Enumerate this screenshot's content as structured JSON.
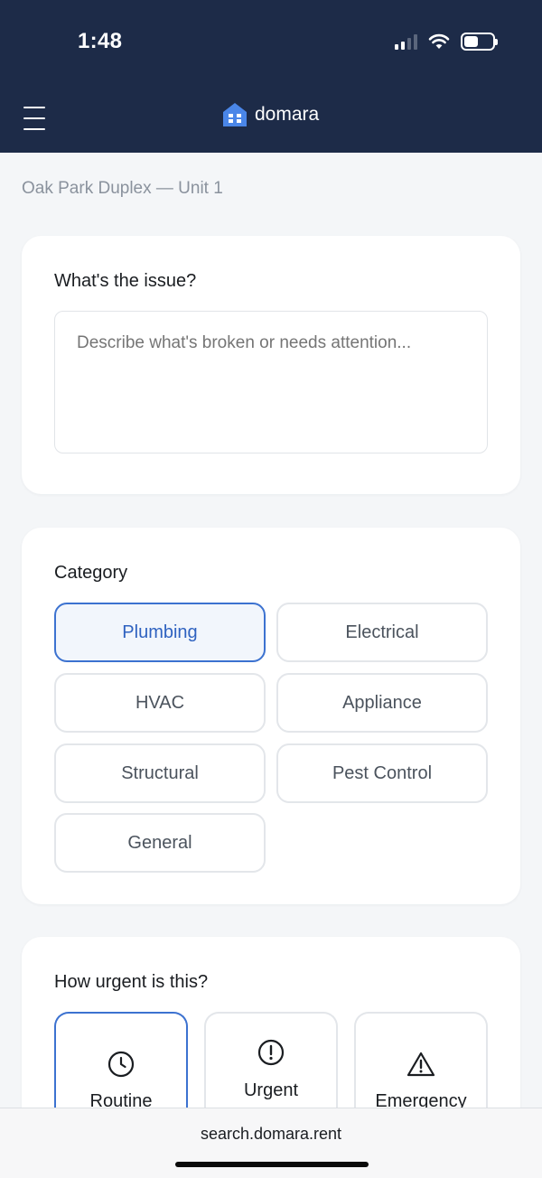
{
  "status_bar": {
    "time": "1:48"
  },
  "header": {
    "brand": "domara"
  },
  "breadcrumb": "Oak Park Duplex — Unit 1",
  "issue": {
    "title": "What's the issue?",
    "placeholder": "Describe what's broken or needs attention..."
  },
  "category": {
    "title": "Category",
    "options": [
      "Plumbing",
      "Electrical",
      "HVAC",
      "Appliance",
      "Structural",
      "Pest Control",
      "General"
    ],
    "selected": "Plumbing"
  },
  "urgency": {
    "title": "How urgent is this?",
    "options": [
      {
        "label": "Routine",
        "icon": "clock-icon"
      },
      {
        "label": "Urgent",
        "icon": "alert-circle-icon"
      },
      {
        "label": "Emergency",
        "icon": "warning-triangle-icon"
      }
    ],
    "selected": "Routine"
  },
  "browser": {
    "url": "search.domara.rent"
  },
  "colors": {
    "header_bg": "#1d2b48",
    "accent": "#3c72d0",
    "page_bg": "#f4f6f8"
  }
}
